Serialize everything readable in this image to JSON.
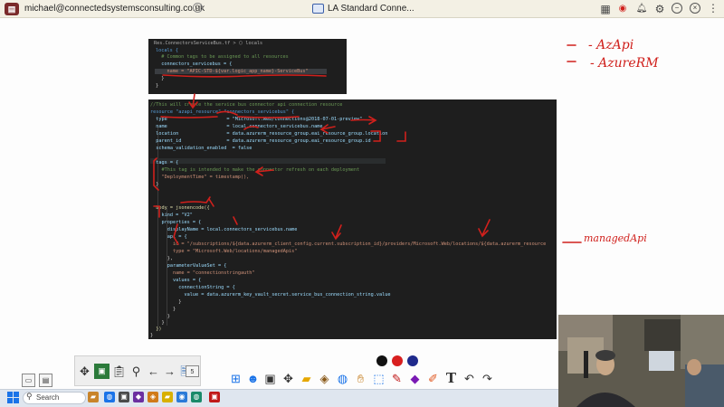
{
  "titlebar": {
    "email": "michael@connectedsystemsconsulting.co.uk",
    "window_title": "LA Standard Conne..."
  },
  "code_snippet_top": {
    "breadcrumb": "Res.ConnectorsServiceBus.tf > ⬡ locals",
    "lines": [
      "locals {",
      "  # Common tags to be assigned to all resources",
      "  connectors_servicebus = {",
      "    name = \"APIC-STD-${var.logic_app_name}-ServiceBus\"",
      "  }",
      "}"
    ]
  },
  "code_snippet_main": {
    "lines": [
      "//This will create the service bus connector api connection resource",
      "resource \"azapi_resource\" \"connectors_servicebus\" {",
      "  type                     = \"Microsoft.Web/connections@2018-07-01-preview\"",
      "  name                     = local.connectors_servicebus.name",
      "  location                 = data.azurerm_resource_group.eai_resource_group.location",
      "  parent_id                = data.azurerm_resource_group.eai_resource_group.id",
      "  schema_validation_enabled  = false",
      "",
      "  tags = {",
      "    #This tag is intended to make the connector refresh on each deployment",
      "    \"DeploymentTime\" = timestamp(),",
      "  }",
      "",
      "",
      "  body = jsonencode({",
      "    kind = \"V2\"",
      "    properties = {",
      "      displayName = local.connectors_servicebus.name",
      "      api = {",
      "        id = \"/subscriptions/${data.azurerm_client_config.current.subscription_id}/providers/Microsoft.Web/locations/${data.azurerm_resource",
      "        type = \"Microsoft.Web/locations/managedApis\"",
      "      },",
      "      parameterValueSet = {",
      "        name = \"connectionstringauth\"",
      "        values = {",
      "          connectionString = {",
      "            value = data.azurerm_key_vault_secret.service_bus_connection_string.value",
      "          }",
      "        }",
      "      }",
      "    }",
      "  })",
      "}"
    ]
  },
  "handwritten_notes": {
    "note1": "- AzApi",
    "note2": "- AzureRM",
    "note3": "managedApi"
  },
  "colors": {
    "ink_red": "#d0201c",
    "pen_black": "#111111",
    "pen_red": "#d81f1f",
    "pen_blue": "#1f2a8c"
  },
  "taskbar": {
    "search_label": "Search"
  }
}
